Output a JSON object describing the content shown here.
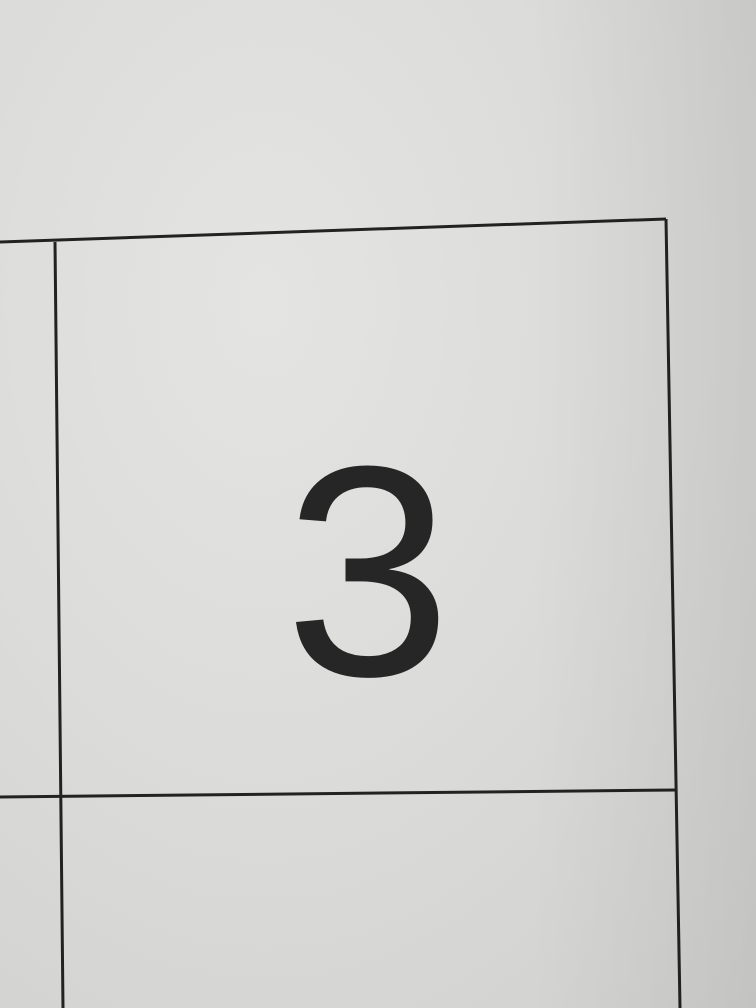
{
  "sheet": {
    "cell_number": "3",
    "ink_color": "#262626",
    "paper_color": "#dcdcda"
  }
}
